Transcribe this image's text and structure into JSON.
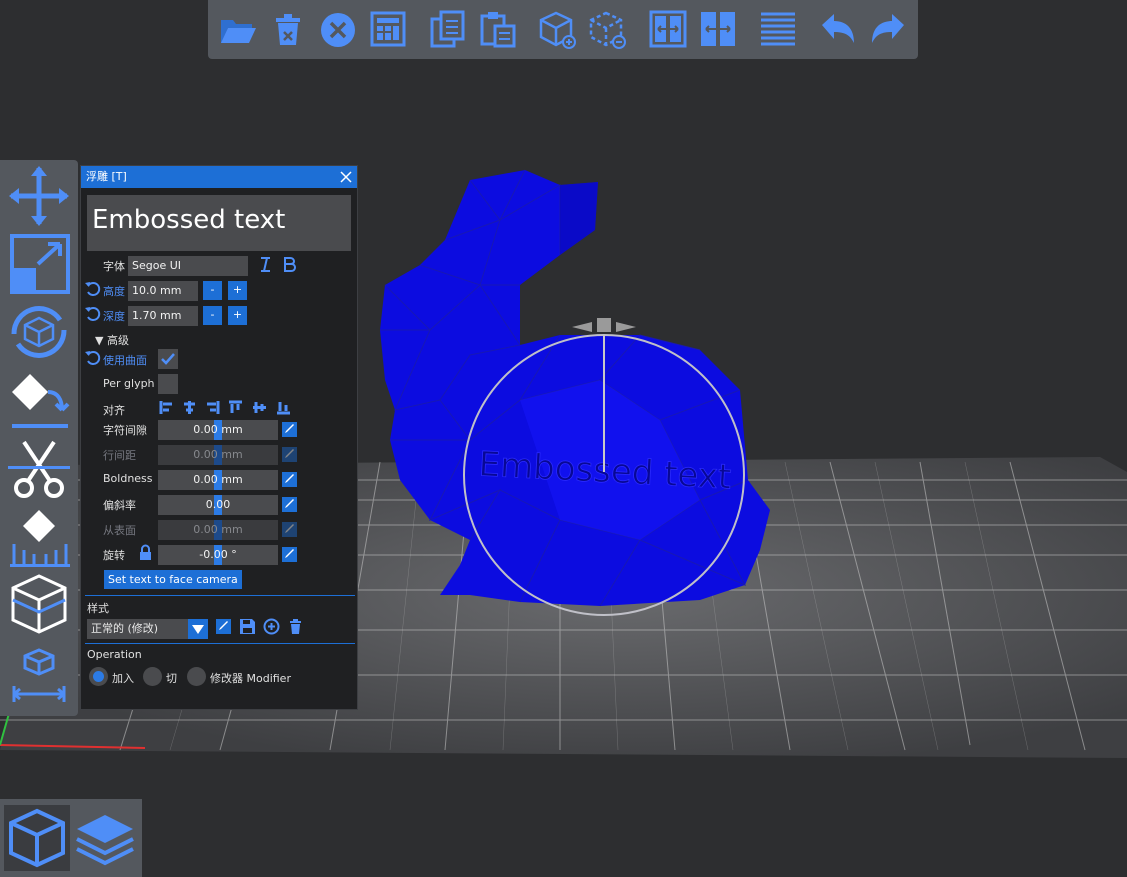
{
  "toolbar": {
    "buttons": [
      {
        "name": "open-folder-icon"
      },
      {
        "name": "delete-icon"
      },
      {
        "name": "delete-all-icon"
      },
      {
        "name": "arrange-icon"
      },
      {
        "name": "copy-icon"
      },
      {
        "name": "paste-icon"
      },
      {
        "name": "add-instance-icon"
      },
      {
        "name": "remove-instance-icon"
      },
      {
        "name": "split-objects-icon"
      },
      {
        "name": "split-parts-icon"
      },
      {
        "name": "layers-editing-icon"
      },
      {
        "name": "undo-icon"
      },
      {
        "name": "redo-icon"
      }
    ]
  },
  "left_toolbar": {
    "tools": [
      "move-icon",
      "scale-icon",
      "rotate-icon",
      "place-on-face-icon",
      "cut-icon",
      "supports-icon",
      "seam-icon",
      "measure-icon"
    ]
  },
  "panel": {
    "title": "浮雕 [T]",
    "text_value": "Embossed text",
    "font_label": "字体",
    "font_value": "Segoe UI",
    "height_label": "高度",
    "height_value": "10.0 mm",
    "depth_label": "深度",
    "depth_value": "1.70 mm",
    "minus": "-",
    "plus": "+",
    "advanced_label": "▼ 高级",
    "use_surface_label": "使用曲面",
    "per_glyph_label": "Per glyph",
    "align_label": "对齐",
    "char_gap_label": "字符间隙",
    "char_gap_value": "0.00 mm",
    "line_gap_label": "行间距",
    "line_gap_value": "0.00 mm",
    "boldness_label": "Boldness",
    "boldness_value": "0.00 mm",
    "skew_label": "偏斜率",
    "skew_value": "0.00",
    "from_surface_label": "从表面",
    "from_surface_value": "0.00 mm",
    "rotation_label": "旋转",
    "rotation_value": "-0.00 °",
    "face_camera_label": "Set text to face camera",
    "style_label": "样式",
    "style_value": "正常的 (修改)",
    "operation_label": "Operation",
    "op_add": "加入",
    "op_cut": "切",
    "op_modifier": "修改器 Modifier"
  },
  "scene": {
    "embossed_preview": "Embossed text"
  },
  "colors": {
    "accent": "#1d6fd6",
    "model": "#0c0ce0",
    "toolbar_bg": "#54585e",
    "icon": "#4f8ef7"
  }
}
